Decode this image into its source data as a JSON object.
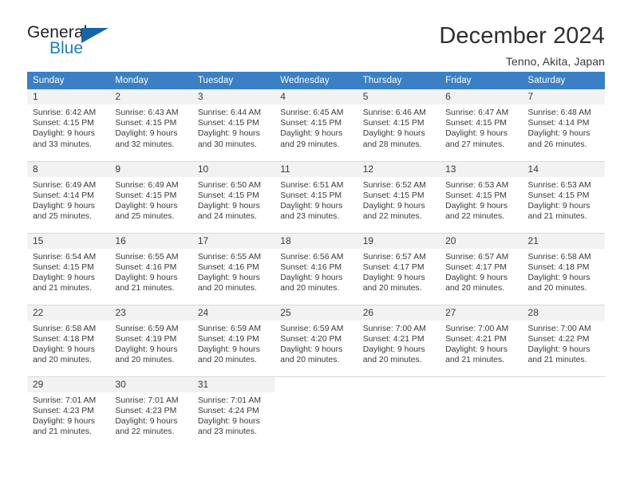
{
  "brand": {
    "name_top": "General",
    "name_bottom": "Blue",
    "triangle_color": "#1665a8",
    "blue_color": "#1a7fc1"
  },
  "header": {
    "title": "December 2024",
    "subtitle": "Tenno, Akita, Japan",
    "header_bg": "#3b7fc4",
    "daynum_bg": "#f2f2f2"
  },
  "weekdays": [
    "Sunday",
    "Monday",
    "Tuesday",
    "Wednesday",
    "Thursday",
    "Friday",
    "Saturday"
  ],
  "weeks": [
    [
      {
        "day": "1",
        "sunrise": "Sunrise: 6:42 AM",
        "sunset": "Sunset: 4:15 PM",
        "daylight1": "Daylight: 9 hours",
        "daylight2": "and 33 minutes."
      },
      {
        "day": "2",
        "sunrise": "Sunrise: 6:43 AM",
        "sunset": "Sunset: 4:15 PM",
        "daylight1": "Daylight: 9 hours",
        "daylight2": "and 32 minutes."
      },
      {
        "day": "3",
        "sunrise": "Sunrise: 6:44 AM",
        "sunset": "Sunset: 4:15 PM",
        "daylight1": "Daylight: 9 hours",
        "daylight2": "and 30 minutes."
      },
      {
        "day": "4",
        "sunrise": "Sunrise: 6:45 AM",
        "sunset": "Sunset: 4:15 PM",
        "daylight1": "Daylight: 9 hours",
        "daylight2": "and 29 minutes."
      },
      {
        "day": "5",
        "sunrise": "Sunrise: 6:46 AM",
        "sunset": "Sunset: 4:15 PM",
        "daylight1": "Daylight: 9 hours",
        "daylight2": "and 28 minutes."
      },
      {
        "day": "6",
        "sunrise": "Sunrise: 6:47 AM",
        "sunset": "Sunset: 4:15 PM",
        "daylight1": "Daylight: 9 hours",
        "daylight2": "and 27 minutes."
      },
      {
        "day": "7",
        "sunrise": "Sunrise: 6:48 AM",
        "sunset": "Sunset: 4:14 PM",
        "daylight1": "Daylight: 9 hours",
        "daylight2": "and 26 minutes."
      }
    ],
    [
      {
        "day": "8",
        "sunrise": "Sunrise: 6:49 AM",
        "sunset": "Sunset: 4:14 PM",
        "daylight1": "Daylight: 9 hours",
        "daylight2": "and 25 minutes."
      },
      {
        "day": "9",
        "sunrise": "Sunrise: 6:49 AM",
        "sunset": "Sunset: 4:15 PM",
        "daylight1": "Daylight: 9 hours",
        "daylight2": "and 25 minutes."
      },
      {
        "day": "10",
        "sunrise": "Sunrise: 6:50 AM",
        "sunset": "Sunset: 4:15 PM",
        "daylight1": "Daylight: 9 hours",
        "daylight2": "and 24 minutes."
      },
      {
        "day": "11",
        "sunrise": "Sunrise: 6:51 AM",
        "sunset": "Sunset: 4:15 PM",
        "daylight1": "Daylight: 9 hours",
        "daylight2": "and 23 minutes."
      },
      {
        "day": "12",
        "sunrise": "Sunrise: 6:52 AM",
        "sunset": "Sunset: 4:15 PM",
        "daylight1": "Daylight: 9 hours",
        "daylight2": "and 22 minutes."
      },
      {
        "day": "13",
        "sunrise": "Sunrise: 6:53 AM",
        "sunset": "Sunset: 4:15 PM",
        "daylight1": "Daylight: 9 hours",
        "daylight2": "and 22 minutes."
      },
      {
        "day": "14",
        "sunrise": "Sunrise: 6:53 AM",
        "sunset": "Sunset: 4:15 PM",
        "daylight1": "Daylight: 9 hours",
        "daylight2": "and 21 minutes."
      }
    ],
    [
      {
        "day": "15",
        "sunrise": "Sunrise: 6:54 AM",
        "sunset": "Sunset: 4:15 PM",
        "daylight1": "Daylight: 9 hours",
        "daylight2": "and 21 minutes."
      },
      {
        "day": "16",
        "sunrise": "Sunrise: 6:55 AM",
        "sunset": "Sunset: 4:16 PM",
        "daylight1": "Daylight: 9 hours",
        "daylight2": "and 21 minutes."
      },
      {
        "day": "17",
        "sunrise": "Sunrise: 6:55 AM",
        "sunset": "Sunset: 4:16 PM",
        "daylight1": "Daylight: 9 hours",
        "daylight2": "and 20 minutes."
      },
      {
        "day": "18",
        "sunrise": "Sunrise: 6:56 AM",
        "sunset": "Sunset: 4:16 PM",
        "daylight1": "Daylight: 9 hours",
        "daylight2": "and 20 minutes."
      },
      {
        "day": "19",
        "sunrise": "Sunrise: 6:57 AM",
        "sunset": "Sunset: 4:17 PM",
        "daylight1": "Daylight: 9 hours",
        "daylight2": "and 20 minutes."
      },
      {
        "day": "20",
        "sunrise": "Sunrise: 6:57 AM",
        "sunset": "Sunset: 4:17 PM",
        "daylight1": "Daylight: 9 hours",
        "daylight2": "and 20 minutes."
      },
      {
        "day": "21",
        "sunrise": "Sunrise: 6:58 AM",
        "sunset": "Sunset: 4:18 PM",
        "daylight1": "Daylight: 9 hours",
        "daylight2": "and 20 minutes."
      }
    ],
    [
      {
        "day": "22",
        "sunrise": "Sunrise: 6:58 AM",
        "sunset": "Sunset: 4:18 PM",
        "daylight1": "Daylight: 9 hours",
        "daylight2": "and 20 minutes."
      },
      {
        "day": "23",
        "sunrise": "Sunrise: 6:59 AM",
        "sunset": "Sunset: 4:19 PM",
        "daylight1": "Daylight: 9 hours",
        "daylight2": "and 20 minutes."
      },
      {
        "day": "24",
        "sunrise": "Sunrise: 6:59 AM",
        "sunset": "Sunset: 4:19 PM",
        "daylight1": "Daylight: 9 hours",
        "daylight2": "and 20 minutes."
      },
      {
        "day": "25",
        "sunrise": "Sunrise: 6:59 AM",
        "sunset": "Sunset: 4:20 PM",
        "daylight1": "Daylight: 9 hours",
        "daylight2": "and 20 minutes."
      },
      {
        "day": "26",
        "sunrise": "Sunrise: 7:00 AM",
        "sunset": "Sunset: 4:21 PM",
        "daylight1": "Daylight: 9 hours",
        "daylight2": "and 20 minutes."
      },
      {
        "day": "27",
        "sunrise": "Sunrise: 7:00 AM",
        "sunset": "Sunset: 4:21 PM",
        "daylight1": "Daylight: 9 hours",
        "daylight2": "and 21 minutes."
      },
      {
        "day": "28",
        "sunrise": "Sunrise: 7:00 AM",
        "sunset": "Sunset: 4:22 PM",
        "daylight1": "Daylight: 9 hours",
        "daylight2": "and 21 minutes."
      }
    ],
    [
      {
        "day": "29",
        "sunrise": "Sunrise: 7:01 AM",
        "sunset": "Sunset: 4:23 PM",
        "daylight1": "Daylight: 9 hours",
        "daylight2": "and 21 minutes."
      },
      {
        "day": "30",
        "sunrise": "Sunrise: 7:01 AM",
        "sunset": "Sunset: 4:23 PM",
        "daylight1": "Daylight: 9 hours",
        "daylight2": "and 22 minutes."
      },
      {
        "day": "31",
        "sunrise": "Sunrise: 7:01 AM",
        "sunset": "Sunset: 4:24 PM",
        "daylight1": "Daylight: 9 hours",
        "daylight2": "and 23 minutes."
      },
      {
        "day": "",
        "sunrise": "",
        "sunset": "",
        "daylight1": "",
        "daylight2": ""
      },
      {
        "day": "",
        "sunrise": "",
        "sunset": "",
        "daylight1": "",
        "daylight2": ""
      },
      {
        "day": "",
        "sunrise": "",
        "sunset": "",
        "daylight1": "",
        "daylight2": ""
      },
      {
        "day": "",
        "sunrise": "",
        "sunset": "",
        "daylight1": "",
        "daylight2": ""
      }
    ]
  ]
}
